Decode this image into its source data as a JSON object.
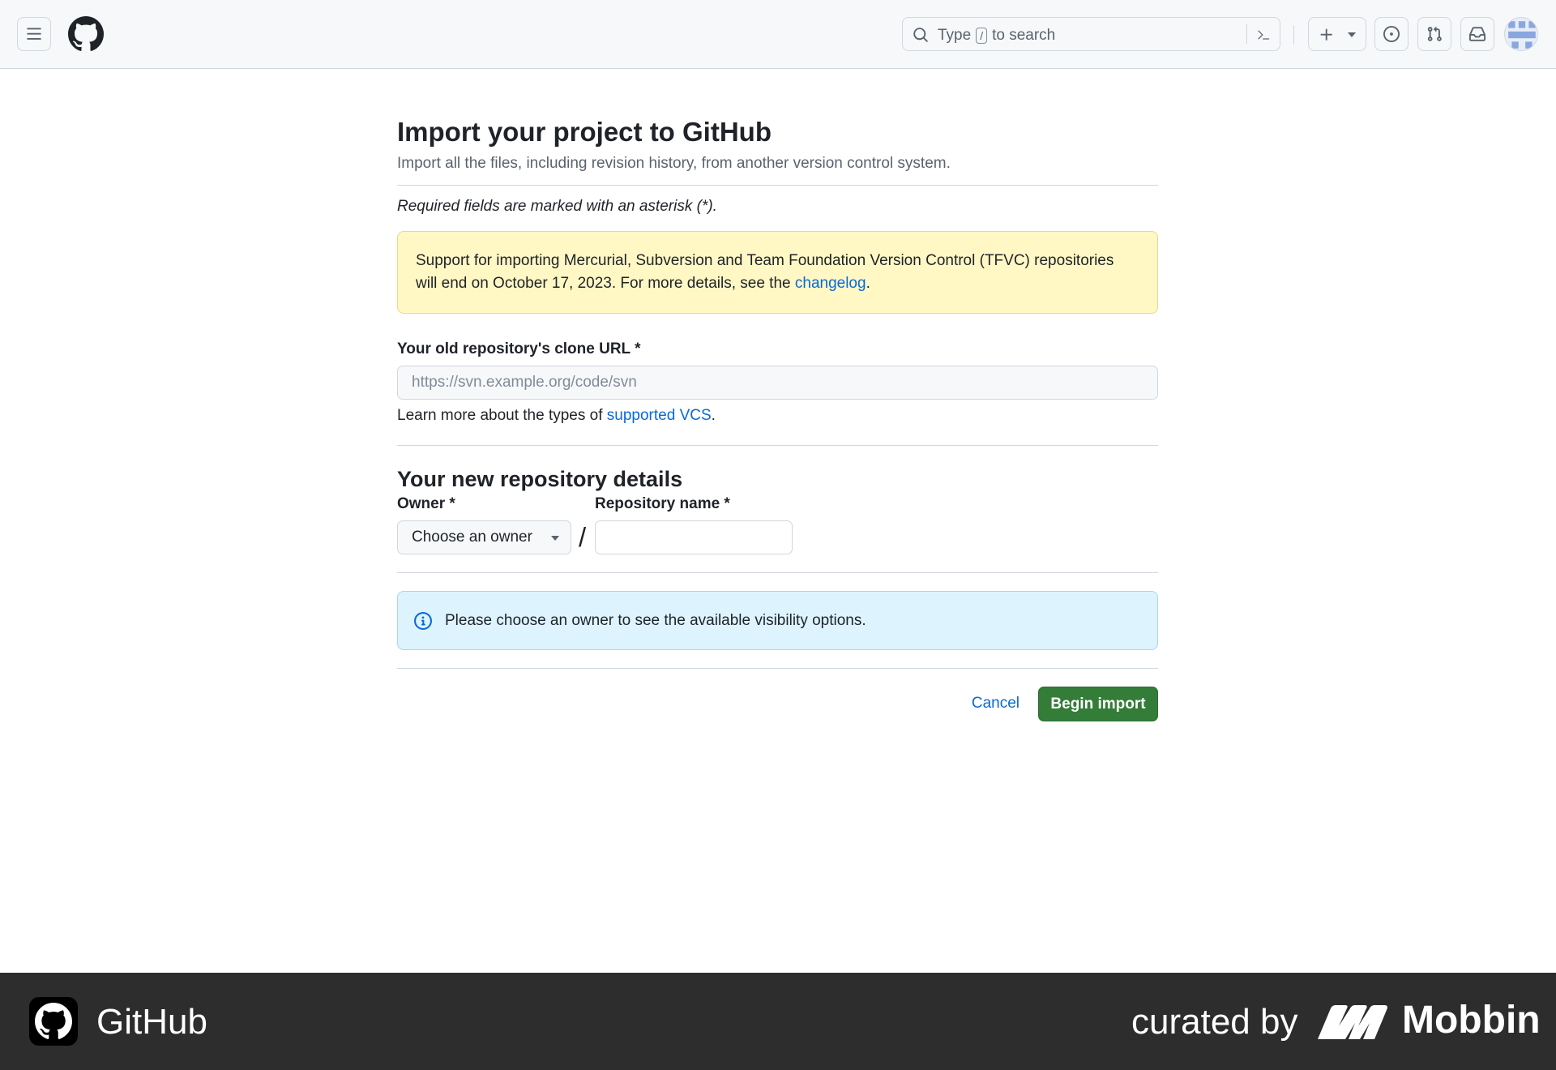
{
  "header": {
    "search_prefix": "Type",
    "search_key": "/",
    "search_suffix": "to search"
  },
  "page": {
    "title": "Import your project to GitHub",
    "subtitle": "Import all the files, including revision history, from another version control system.",
    "required_note": "Required fields are marked with an asterisk (*)."
  },
  "warning": {
    "text": "Support for importing Mercurial, Subversion and Team Foundation Version Control (TFVC) repositories will end on October 17, 2023. For more details, see the",
    "link": "changelog",
    "end": "."
  },
  "clone_url": {
    "label": "Your old repository's clone URL *",
    "placeholder": "https://svn.example.org/code/svn",
    "learn_prefix": "Learn more about the types of",
    "learn_link": "supported VCS",
    "learn_end": "."
  },
  "details": {
    "heading": "Your new repository details",
    "owner_label": "Owner *",
    "owner_button": "Choose an owner",
    "separator": "/",
    "repo_label": "Repository name *"
  },
  "info": {
    "text": "Please choose an owner to see the available visibility options."
  },
  "actions": {
    "cancel": "Cancel",
    "begin": "Begin import"
  },
  "footer": {
    "brand": "GitHub",
    "curated": "curated by",
    "mobbin": "Mobbin"
  },
  "colors": {
    "accent": "#0969da",
    "primary_button": "#347d39",
    "warning_bg": "#fff8c5",
    "info_bg": "#ddf4ff",
    "footer_bg": "#2d2d2d"
  }
}
